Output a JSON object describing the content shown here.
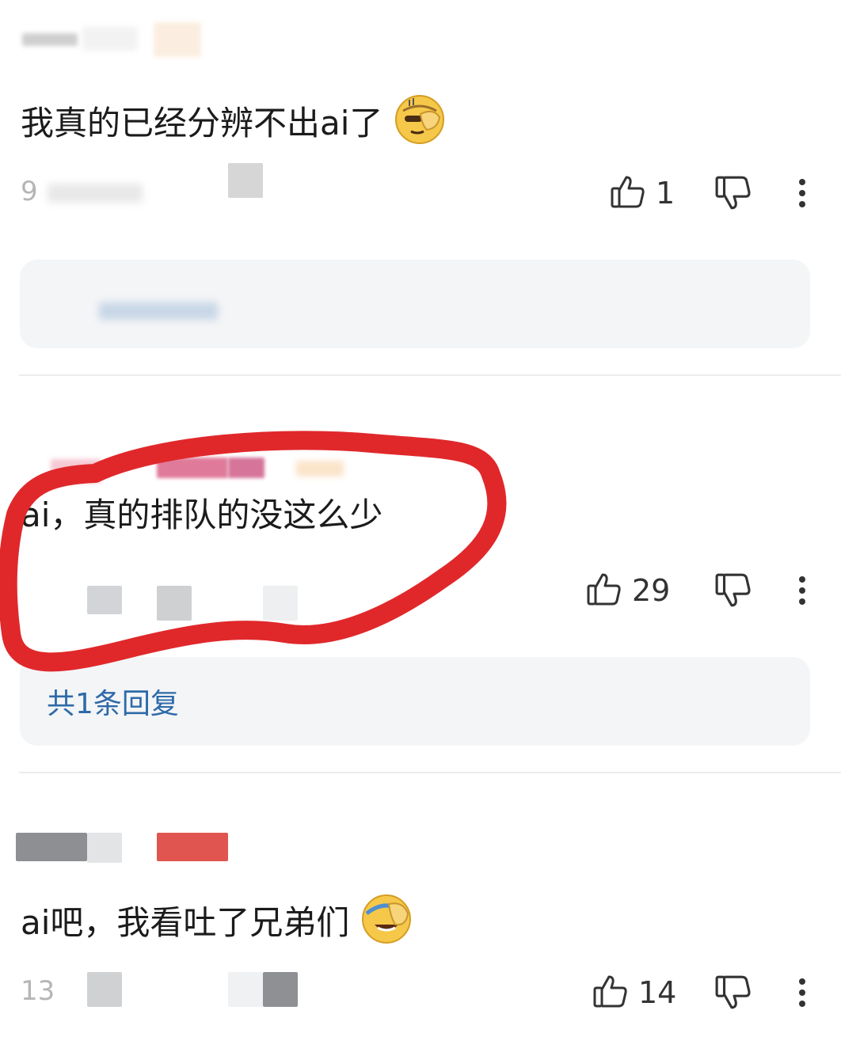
{
  "comments": [
    {
      "text": "我真的已经分辨不出ai了",
      "emoji": "facepalm-emoji",
      "meta_visible": "9",
      "likes": "1",
      "reply_link": "",
      "has_reply_panel": true
    },
    {
      "text": "ai，真的排队的没这么少",
      "emoji": "",
      "meta_visible": "",
      "likes": "29",
      "reply_link": "共1条回复",
      "has_reply_panel": true
    },
    {
      "text": "ai吧，我看吐了兄弟们",
      "emoji": "laughing-cover-face-emoji",
      "meta_visible": "13",
      "likes": "14",
      "reply_link": "",
      "has_reply_panel": false
    }
  ],
  "icons": {
    "like": "thumbs-up-icon",
    "dislike": "thumbs-down-icon",
    "more": "more-vertical-icon"
  },
  "colors": {
    "annotation_red": "#e0282b",
    "reply_blue": "#2e6aa8",
    "panel_bg": "#f4f5f7"
  }
}
